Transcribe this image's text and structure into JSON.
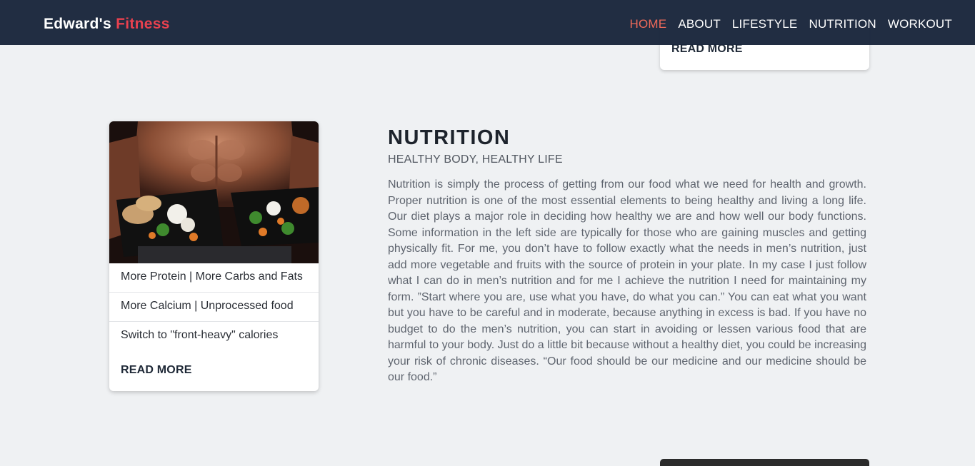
{
  "brand": {
    "name_primary": "Edward's",
    "name_accent": "Fitness"
  },
  "nav": {
    "items": [
      {
        "label": "HOME",
        "active": true
      },
      {
        "label": "ABOUT",
        "active": false
      },
      {
        "label": "LIFESTYLE",
        "active": false
      },
      {
        "label": "NUTRITION",
        "active": false
      },
      {
        "label": "WORKOUT",
        "active": false
      }
    ]
  },
  "colors": {
    "nav_bg": "#18243a",
    "accent": "#e8414f",
    "active_link": "#f06a5a",
    "page_bg": "#eff1f3"
  },
  "prev_card": {
    "read_more": "READ MORE"
  },
  "nutrition_card": {
    "image_alt": "man holding meal prep containers",
    "items": [
      "More Protein | More Carbs and Fats",
      "More Calcium | Unprocessed food",
      "Switch to \"front-heavy\" calories"
    ],
    "read_more": "READ MORE"
  },
  "article": {
    "title": "NUTRITION",
    "subtitle": "HEALTHY BODY, HEALTHY LIFE",
    "body": "Nutrition is simply the process of getting from our food what we need for health and growth. Proper nutrition is one of the most essential elements to being healthy and living a long life. Our diet plays a major role in deciding how healthy we are and how well our body functions. Some information in the left side are typically for those who are gaining muscles and getting physically fit. For me, you don’t have to follow exactly what the needs in men’s nutrition, just add more vegetable and fruits with the source of protein in your plate. In my case I just follow what I can do in men’s nutrition and for me I achieve the nutrition I need for maintaining my form. ”Start where you are, use what you have, do what you can.” You can eat what you want but you have to be careful and in moderate, because anything in excess is bad. If you have no budget to do the men’s nutrition, you can start in avoiding or lessen various food that are harmful to your body. Just do a little bit because without a healthy diet, you could be increasing your risk of chronic diseases. “Our food should be our medicine and our medicine should be our food.”"
  }
}
